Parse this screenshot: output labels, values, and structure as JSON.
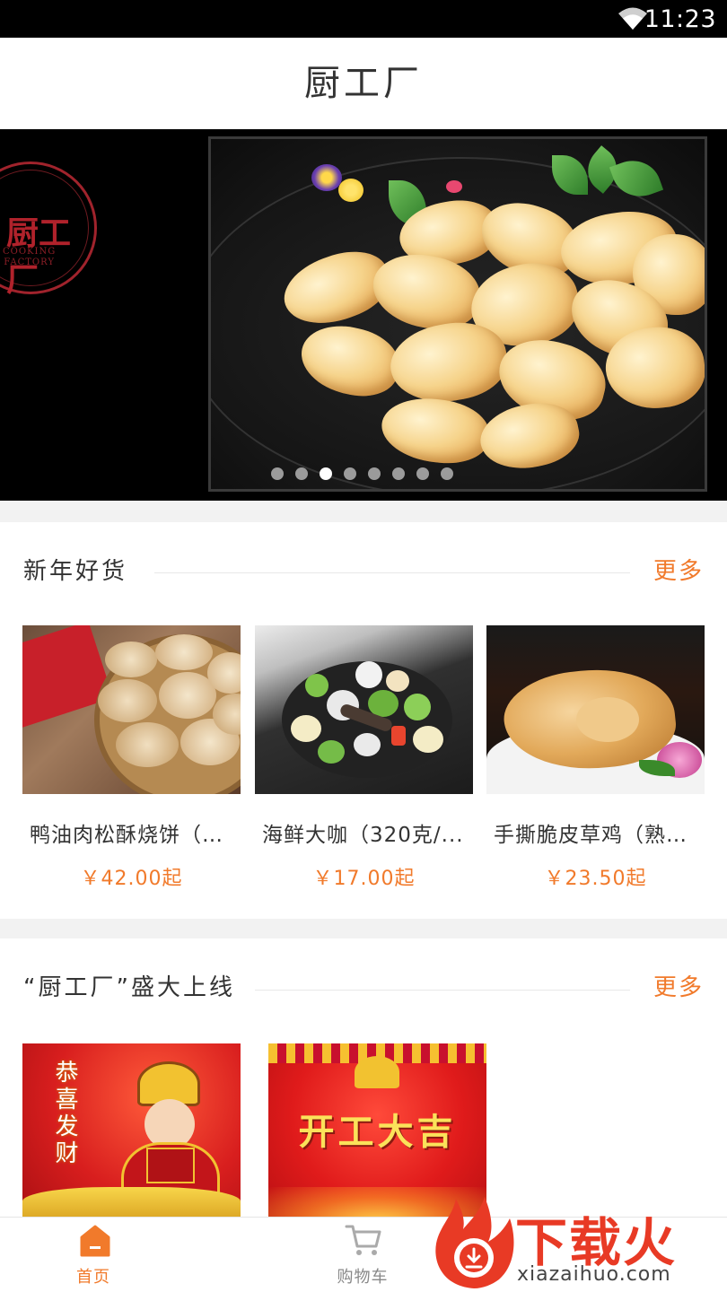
{
  "status_bar": {
    "time": "11:23",
    "icons": [
      "wifi-icon"
    ]
  },
  "header": {
    "title": "厨工厂"
  },
  "banner": {
    "logo_text": "厨工厂",
    "logo_subtitle_1": "COOKING",
    "logo_subtitle_2": "FACTORY",
    "page_count": 8,
    "active_index": 2
  },
  "sections": [
    {
      "title": "新年好货",
      "more_label": "更多",
      "products": [
        {
          "name": "鸭油肉松酥烧饼（6...",
          "price": "￥42.00起"
        },
        {
          "name": "海鲜大咖（320克/...",
          "price": "￥17.00起"
        },
        {
          "name": "手撕脆皮草鸡（熟制...",
          "price": "￥23.50起"
        }
      ]
    },
    {
      "title": "“厨工厂”盛大上线",
      "more_label": "更多",
      "posters": [
        {
          "text": "恭喜发财"
        },
        {
          "text": "开工大吉"
        }
      ]
    }
  ],
  "tab_bar": {
    "tabs": [
      {
        "label": "首页",
        "icon": "home-icon",
        "active": true
      },
      {
        "label": "购物车",
        "icon": "cart-icon",
        "active": false
      }
    ]
  },
  "watermark": {
    "text": "下载火",
    "url": "xiazaihuo.com"
  },
  "colors": {
    "accent": "#f17a2b",
    "status_bar": "#000000",
    "logo_red": "#a0232c"
  }
}
